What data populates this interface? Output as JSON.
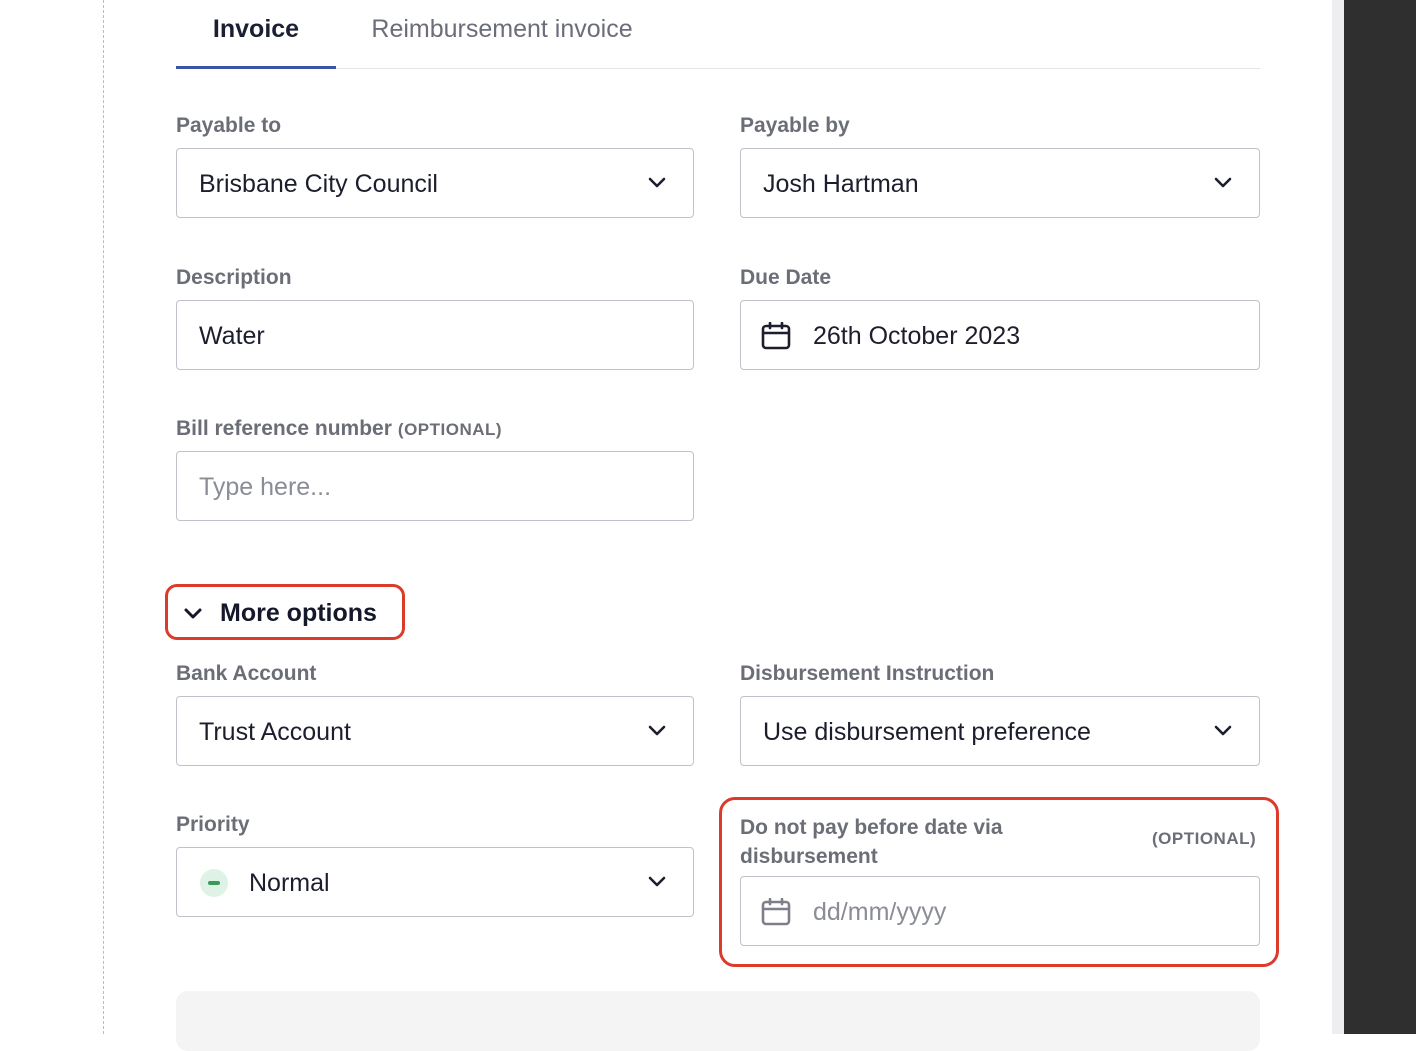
{
  "tabs": [
    {
      "label": "Invoice",
      "active": true
    },
    {
      "label": "Reimbursement invoice",
      "active": false
    }
  ],
  "payable_to": {
    "label": "Payable to",
    "value": "Brisbane City Council"
  },
  "payable_by": {
    "label": "Payable by",
    "value": "Josh Hartman"
  },
  "description": {
    "label": "Description",
    "value": "Water"
  },
  "due_date": {
    "label": "Due Date",
    "value": "26th October 2023"
  },
  "bill_reference": {
    "label": "Bill reference number",
    "optional": "(OPTIONAL)",
    "placeholder": "Type here..."
  },
  "more_options": {
    "label": "More options"
  },
  "bank_account": {
    "label": "Bank Account",
    "value": "Trust Account"
  },
  "disbursement_instruction": {
    "label": "Disbursement Instruction",
    "value": "Use disbursement preference"
  },
  "priority": {
    "label": "Priority",
    "value": "Normal"
  },
  "do_not_pay": {
    "label_line1": "Do not pay before date via",
    "label_line2": "disbursement",
    "optional": "(OPTIONAL)",
    "placeholder": "dd/mm/yyyy"
  },
  "colors": {
    "accent": "#3b55a4",
    "highlight": "#dc3b2a",
    "priority_green": "#3a9a5c"
  }
}
